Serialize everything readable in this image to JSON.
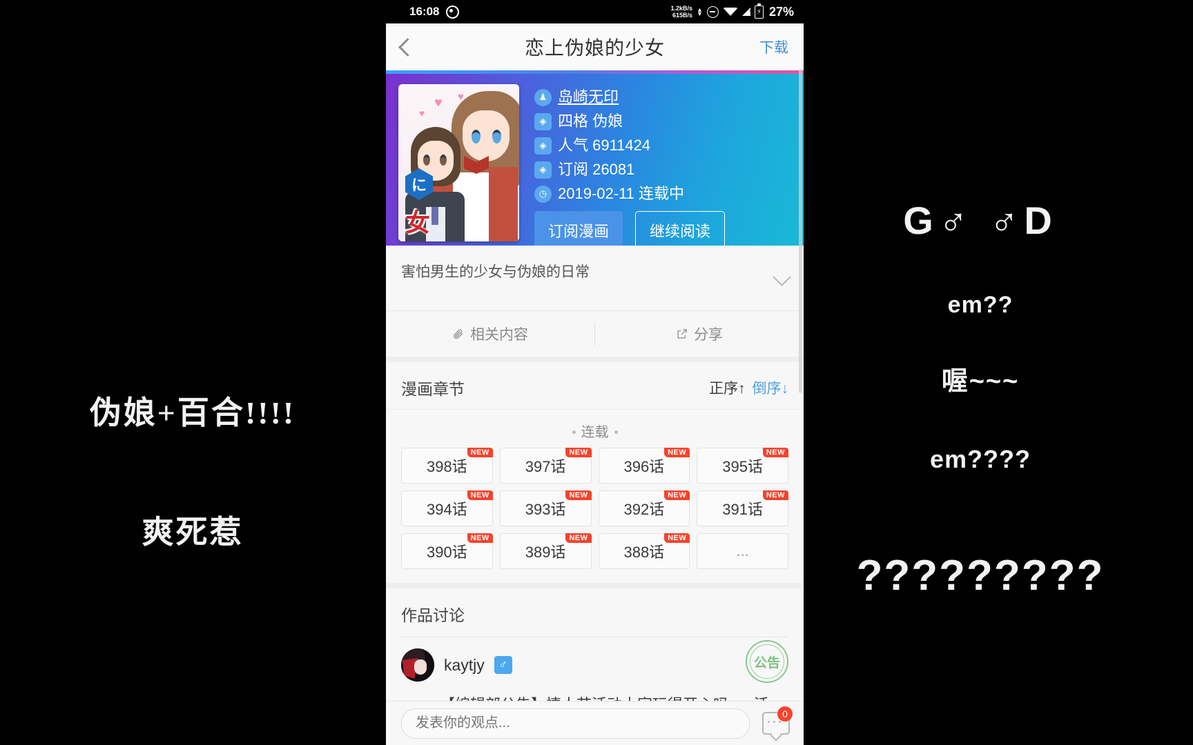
{
  "overlays": {
    "left": {
      "line1": "伪娘+百合!!!!",
      "line2": "爽死惹"
    },
    "right": {
      "god": "G♂ ♂D",
      "em1": "em??",
      "wo": "喔~~~",
      "em2": "em????",
      "questions": "?????????"
    }
  },
  "statusbar": {
    "time": "16:08",
    "recording_icon": "record-dot-icon",
    "net_up": "1.2kB/s",
    "net_down": "615B/s",
    "mute_icon": "do-not-disturb-icon",
    "wifi_icon": "wifi-icon",
    "signal_icon": "signal-no-service-icon",
    "battery_icon": "battery-charging-icon",
    "battery_pct": "27%"
  },
  "appbar": {
    "back_icon": "back-chevron-icon",
    "title": "恋上伪娘的少女",
    "download_label": "下载"
  },
  "hero": {
    "cover": {
      "logo_glyph": "に",
      "title_glyph": "女",
      "alt": "comic-cover-art"
    },
    "meta": [
      {
        "icon": "author-icon",
        "icon_glyph": "♟",
        "label": "岛崎无印",
        "link": true
      },
      {
        "icon": "tag-icon",
        "icon_glyph": "◈",
        "label": "四格 伪娘",
        "link": false
      },
      {
        "icon": "tag-icon",
        "icon_glyph": "◈",
        "label": "人气 6911424",
        "link": false
      },
      {
        "icon": "tag-icon",
        "icon_glyph": "◈",
        "label": "订阅 26081",
        "link": false
      },
      {
        "icon": "clock-icon",
        "icon_glyph": "◷",
        "label": "2019-02-11 连载中",
        "link": false
      }
    ],
    "subscribe_label": "订阅漫画",
    "continue_label": "继续阅读"
  },
  "description": {
    "text": "害怕男生的少女与伪娘的日常",
    "expand_icon": "chevron-down-icon"
  },
  "actions": [
    {
      "icon": "paperclip-icon",
      "label": "相关内容"
    },
    {
      "icon": "share-icon",
      "label": "分享"
    }
  ],
  "chapters": {
    "title": "漫画章节",
    "sort_asc": "正序↑",
    "sort_desc": "倒序↓",
    "group_label": "连载",
    "items": [
      {
        "label": "398话",
        "new": true
      },
      {
        "label": "397话",
        "new": true
      },
      {
        "label": "396话",
        "new": true
      },
      {
        "label": "395话",
        "new": true
      },
      {
        "label": "394话",
        "new": true
      },
      {
        "label": "393话",
        "new": true
      },
      {
        "label": "392话",
        "new": true
      },
      {
        "label": "391话",
        "new": true
      },
      {
        "label": "390话",
        "new": true
      },
      {
        "label": "389话",
        "new": true
      },
      {
        "label": "388话",
        "new": true
      },
      {
        "label": "...",
        "new": false
      }
    ],
    "new_badge": "NEW"
  },
  "discussion": {
    "title": "作品讨论",
    "comment": {
      "username": "kaytjy",
      "gender_glyph": "♂",
      "stamp_label": "公告",
      "body": "【编辑部公告】情人节活动大家玩得开心吗......活"
    }
  },
  "commentbar": {
    "placeholder": "发表你的观点...",
    "icon": "comment-bubble-icon",
    "count": "0"
  },
  "colors": {
    "accent_blue": "#4a93e8",
    "link_blue": "#3f8fd8",
    "new_red": "#f5432c",
    "stamp_green": "#6fbb72"
  }
}
